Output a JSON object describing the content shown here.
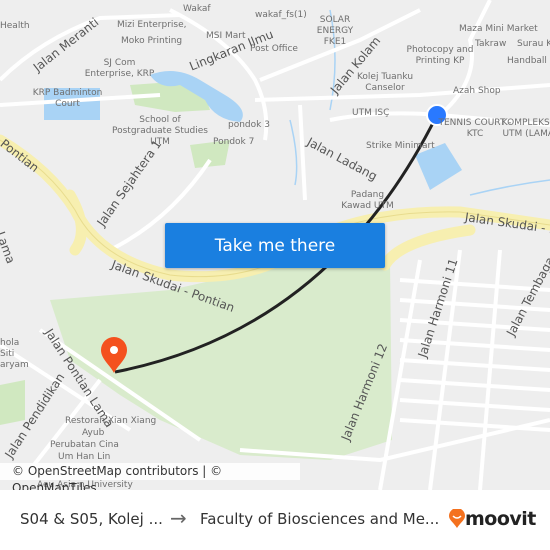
{
  "map": {
    "labels": {
      "health": "Health",
      "wakaf": "Wakaf",
      "wakaf_fs": "wakaf_fs(1)",
      "solar": "SOLAR ENERGY FKE1",
      "mizi": "Mizi Enterprise,",
      "moko": "Moko Printing",
      "msi": "MSI Mart",
      "post": "Post Office",
      "sjcom": "SJ Com Enterprise, KRP",
      "krp": "KRP Badminton Court",
      "postgrad": "School of Postgraduate Studies UTM",
      "pondok3": "pondok 3",
      "pondok7": "Pondok 7",
      "maza": "Maza Mini Market",
      "surau": "Surau KS",
      "takraw": "Takraw",
      "handball": "Handball",
      "photocopy": "Photocopy and Printing KP",
      "kolej": "Kolej Tuanku Canselor",
      "azah": "Azah Shop",
      "utmisc": "UTM ISÇ",
      "tennis": "TENNIS COURT - KTC",
      "kompleks": "KOMPLEKS S UTM (LAMA)",
      "strike": "Strike Minimart",
      "padang": "Padang Kawad UTM",
      "sekolah": "hola Siti aryam",
      "restoran": "Restoran Xian Xiang",
      "ayub": "Ayub",
      "perubatan": "Perubatan Cina",
      "umhan": "Um Han Lin",
      "asia": "Aeu Asia n University"
    },
    "roads": {
      "meranti": "Jalan Meranti",
      "lingkaran": "Lingkaran Ilmu",
      "kolam": "Jalan Kolam",
      "ladang": "Jalan Ladang",
      "sejahtera": "Jalan Sejahtera 1",
      "pontian_left": "Pontian",
      "skudai_main": "Jalan Skudai - Pontian",
      "skudai_right": "Jalan Skudai - P",
      "lama_left": "Lama",
      "pontian_lama": "Jalan Pontian Lama",
      "pendidikan": "Jalan Pendidikan",
      "harmoni11": "Jalan Harmoni 11",
      "harmoni12": "Jalan Harmoni 12",
      "tembaga": "Jalan Tembaga"
    },
    "cta_label": "Take me there",
    "attribution": "© OpenStreetMap contributors | © OpenMapTiles",
    "colors": {
      "origin": "#2979ff",
      "destination": "#f4511e",
      "route": "#222222",
      "highway": "#f7efb0",
      "water": "#a9d3f5",
      "park": "#d7ebc9"
    }
  },
  "footer": {
    "from": "S04 & S05, Kolej ...",
    "to": "Faculty of Biosciences and Me...",
    "brand": "moovit"
  }
}
